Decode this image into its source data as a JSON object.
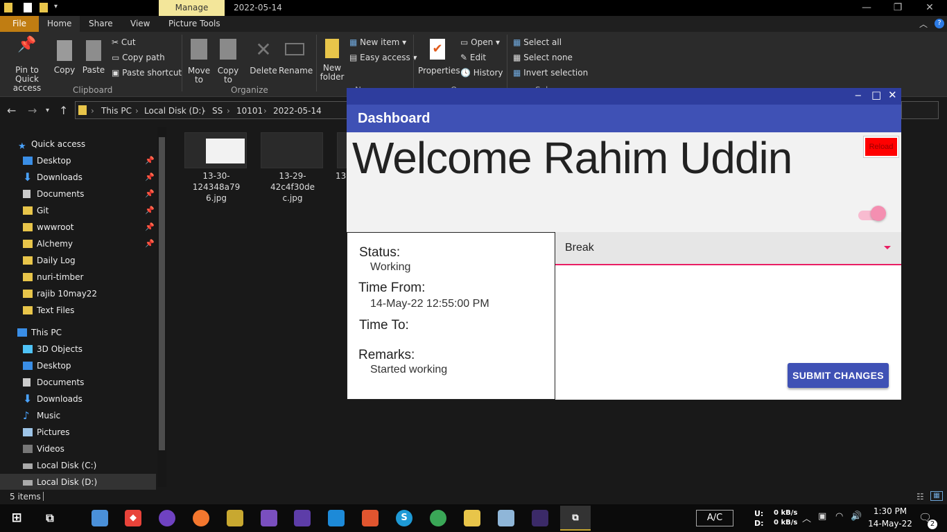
{
  "explorer": {
    "title_tab": "Manage",
    "title": "2022-05-14",
    "ribbon_tabs": [
      "File",
      "Home",
      "Share",
      "View",
      "Picture Tools"
    ],
    "clipboard": {
      "pin_label": "Pin to Quick access",
      "copy_label": "Copy",
      "paste_label": "Paste",
      "cut_label": "Cut",
      "copy_path_label": "Copy path",
      "paste_shortcut_label": "Paste shortcut",
      "group_label": "Clipboard"
    },
    "organize": {
      "move_to_label": "Move to",
      "copy_to_label": "Copy to",
      "delete_label": "Delete",
      "rename_label": "Rename",
      "group_label": "Organize"
    },
    "new": {
      "new_folder_label": "New folder",
      "new_item_label": "New item",
      "easy_access_label": "Easy access",
      "group_label": "N"
    },
    "open": {
      "properties_label": "Properties",
      "open_label": "Open",
      "edit_label": "Edit",
      "history_label": "History",
      "group_label": "O"
    },
    "select": {
      "select_all_label": "Select all",
      "select_none_label": "Select none",
      "invert_label": "Invert selection",
      "group_label": "Sel"
    },
    "breadcrumbs": [
      "This PC",
      "Local Disk (D:)",
      "SS",
      "10101",
      "2022-05-14"
    ],
    "nav_items": [
      {
        "label": "Quick access",
        "pinned": false
      },
      {
        "label": "Desktop",
        "pinned": true
      },
      {
        "label": "Downloads",
        "pinned": true
      },
      {
        "label": "Documents",
        "pinned": true
      },
      {
        "label": "Git",
        "pinned": true
      },
      {
        "label": "wwwroot",
        "pinned": true
      },
      {
        "label": "Alchemy",
        "pinned": true
      },
      {
        "label": "Daily Log",
        "pinned": false
      },
      {
        "label": "nuri-timber",
        "pinned": false
      },
      {
        "label": "rajib 10may22",
        "pinned": false
      },
      {
        "label": "Text Files",
        "pinned": false
      },
      {
        "label": "This PC",
        "pinned": false
      },
      {
        "label": "3D Objects",
        "pinned": false
      },
      {
        "label": "Desktop",
        "pinned": false
      },
      {
        "label": "Documents",
        "pinned": false
      },
      {
        "label": "Downloads",
        "pinned": false
      },
      {
        "label": "Music",
        "pinned": false
      },
      {
        "label": "Pictures",
        "pinned": false
      },
      {
        "label": "Videos",
        "pinned": false
      },
      {
        "label": "Local Disk (C:)",
        "pinned": false
      },
      {
        "label": "Local Disk (D:)",
        "pinned": false
      }
    ],
    "files": [
      {
        "name_line1": "13-30-124348a79",
        "name_line2": "6.jpg"
      },
      {
        "name_line1": "13-29-42c4f30de",
        "name_line2": "c.jpg"
      },
      {
        "name_line1": "13",
        "name_line2": ""
      }
    ],
    "status": "5 items"
  },
  "taskbar": {
    "ac_label": "A/C",
    "net_up_label": "U:",
    "net_down_label": "D:",
    "net_up": "0 kB/s",
    "net_down": "0 kB/s",
    "time": "1:30 PM",
    "date": "14-May-22",
    "notifications": "2"
  },
  "app": {
    "header_title": "Dashboard",
    "welcome_word": "Welcome",
    "user_name": "Rahim Uddin",
    "reload_label": "Reload",
    "status_label": "Status:",
    "status_value": "Working",
    "time_from_label": "Time From:",
    "time_from_value": "14-May-22 12:55:00 PM",
    "time_to_label": "Time To:",
    "time_to_value": "",
    "remarks_label": "Remarks:",
    "remarks_value": "Started working",
    "select_value": "Break",
    "submit_label": "SUBMIT CHANGES",
    "toggle_on": true
  },
  "colors": {
    "app_primary": "#3f51b5",
    "accent_pink": "#e91e63",
    "reload_red": "#ff0000",
    "file_tab": "#c07d12",
    "manage_tab": "#f3e69a"
  }
}
